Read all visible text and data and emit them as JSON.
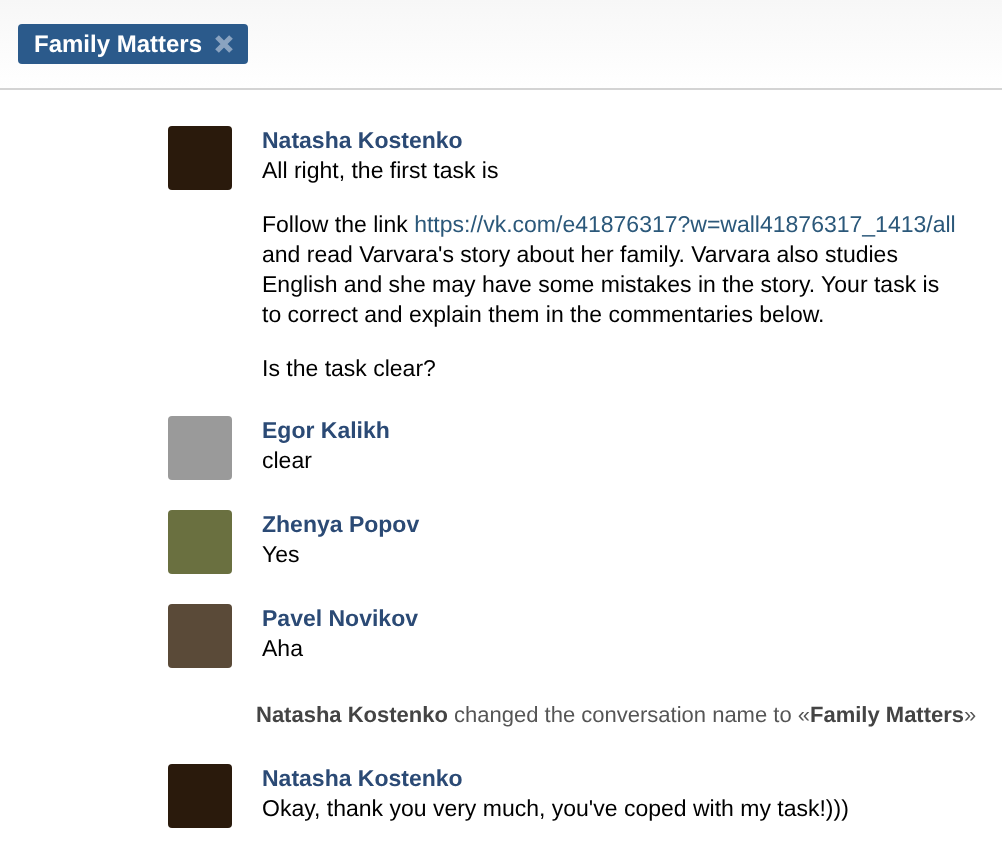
{
  "tab": {
    "title": "Family Matters"
  },
  "messages": [
    {
      "kind": "message",
      "author": "Natasha Kostenko",
      "paragraphs": [
        [
          {
            "text": "All right, the first task is"
          }
        ],
        [
          {
            "text": "Follow the link "
          },
          {
            "link": "https://vk.com/e41876317?w=wall41876317_1413/all"
          },
          {
            "text": " and read Varvara's story about her family. Varvara also studies English and she may have some mistakes in the story. Your task is to correct and explain them in the commentaries below."
          }
        ],
        [
          {
            "text": "Is the task clear?"
          }
        ]
      ]
    },
    {
      "kind": "message",
      "author": "Egor Kalikh",
      "paragraphs": [
        [
          {
            "text": "clear"
          }
        ]
      ]
    },
    {
      "kind": "message",
      "author": "Zhenya Popov",
      "paragraphs": [
        [
          {
            "text": "Yes"
          }
        ]
      ]
    },
    {
      "kind": "message",
      "author": "Pavel Novikov",
      "paragraphs": [
        [
          {
            "text": "Aha"
          }
        ]
      ]
    },
    {
      "kind": "system",
      "text": "**Natasha Kostenko** changed the conversation name to «**Family Matters**»"
    },
    {
      "kind": "message",
      "author": "Natasha Kostenko",
      "paragraphs": [
        [
          {
            "text": "Okay, thank you very much, you've coped with my task!)))"
          }
        ]
      ]
    }
  ]
}
